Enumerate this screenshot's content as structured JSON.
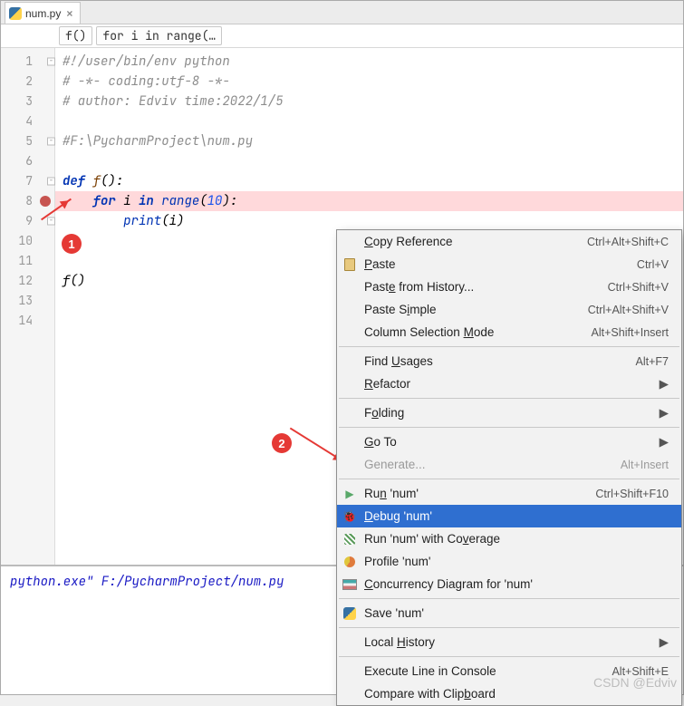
{
  "tab": {
    "filename": "num.py"
  },
  "crumbs": {
    "a": "f()",
    "b": "for i in range(…"
  },
  "gutter": [
    "1",
    "2",
    "3",
    "4",
    "5",
    "6",
    "7",
    "8",
    "9",
    "10",
    "11",
    "12",
    "13",
    "14"
  ],
  "code": {
    "l1_cmt": "#!/user/bin/env python",
    "l2_cmt": "# -*- coding:utf-8 -*-",
    "l3_cmt": "# author: Edviv time:2022/1/5",
    "l5_cmt": "#F:\\PycharmProject\\num.py",
    "def": "def",
    "fname": "f",
    "paren_colon": "():",
    "for": "for",
    "var": "i",
    "in": "in",
    "range": "range",
    "ten": "10",
    "print": "print",
    "call": "f()"
  },
  "console": {
    "line": "python.exe\" F:/PycharmProject/num.py"
  },
  "menu": {
    "copy_ref": {
      "label": "Copy Reference",
      "shortcut": "Ctrl+Alt+Shift+C"
    },
    "paste": {
      "label": "Paste",
      "shortcut": "Ctrl+V"
    },
    "paste_hist": {
      "label": "Paste from History...",
      "shortcut": "Ctrl+Shift+V"
    },
    "paste_simp": {
      "label": "Paste Simple",
      "shortcut": "Ctrl+Alt+Shift+V"
    },
    "colsel": {
      "label": "Column Selection Mode",
      "shortcut": "Alt+Shift+Insert"
    },
    "find_usg": {
      "label": "Find Usages",
      "shortcut": "Alt+F7"
    },
    "refactor": {
      "label": "Refactor"
    },
    "folding": {
      "label": "Folding"
    },
    "goto": {
      "label": "Go To"
    },
    "generate": {
      "label": "Generate...",
      "shortcut": "Alt+Insert"
    },
    "run": {
      "label": "Run 'num'",
      "shortcut": "Ctrl+Shift+F10"
    },
    "debug": {
      "label": "Debug 'num'"
    },
    "coverage": {
      "label": "Run 'num' with Coverage"
    },
    "profile": {
      "label": "Profile 'num'"
    },
    "concurrency": {
      "label": "Concurrency Diagram for  'num'"
    },
    "save": {
      "label": "Save 'num'"
    },
    "local_hist": {
      "label": "Local History"
    },
    "exec_line": {
      "label": "Execute Line in Console",
      "shortcut": "Alt+Shift+E"
    },
    "cmp_clip": {
      "label": "Compare with Clipboard"
    }
  },
  "annot": {
    "one": "1",
    "two": "2"
  },
  "watermark": "CSDN @Edviv"
}
